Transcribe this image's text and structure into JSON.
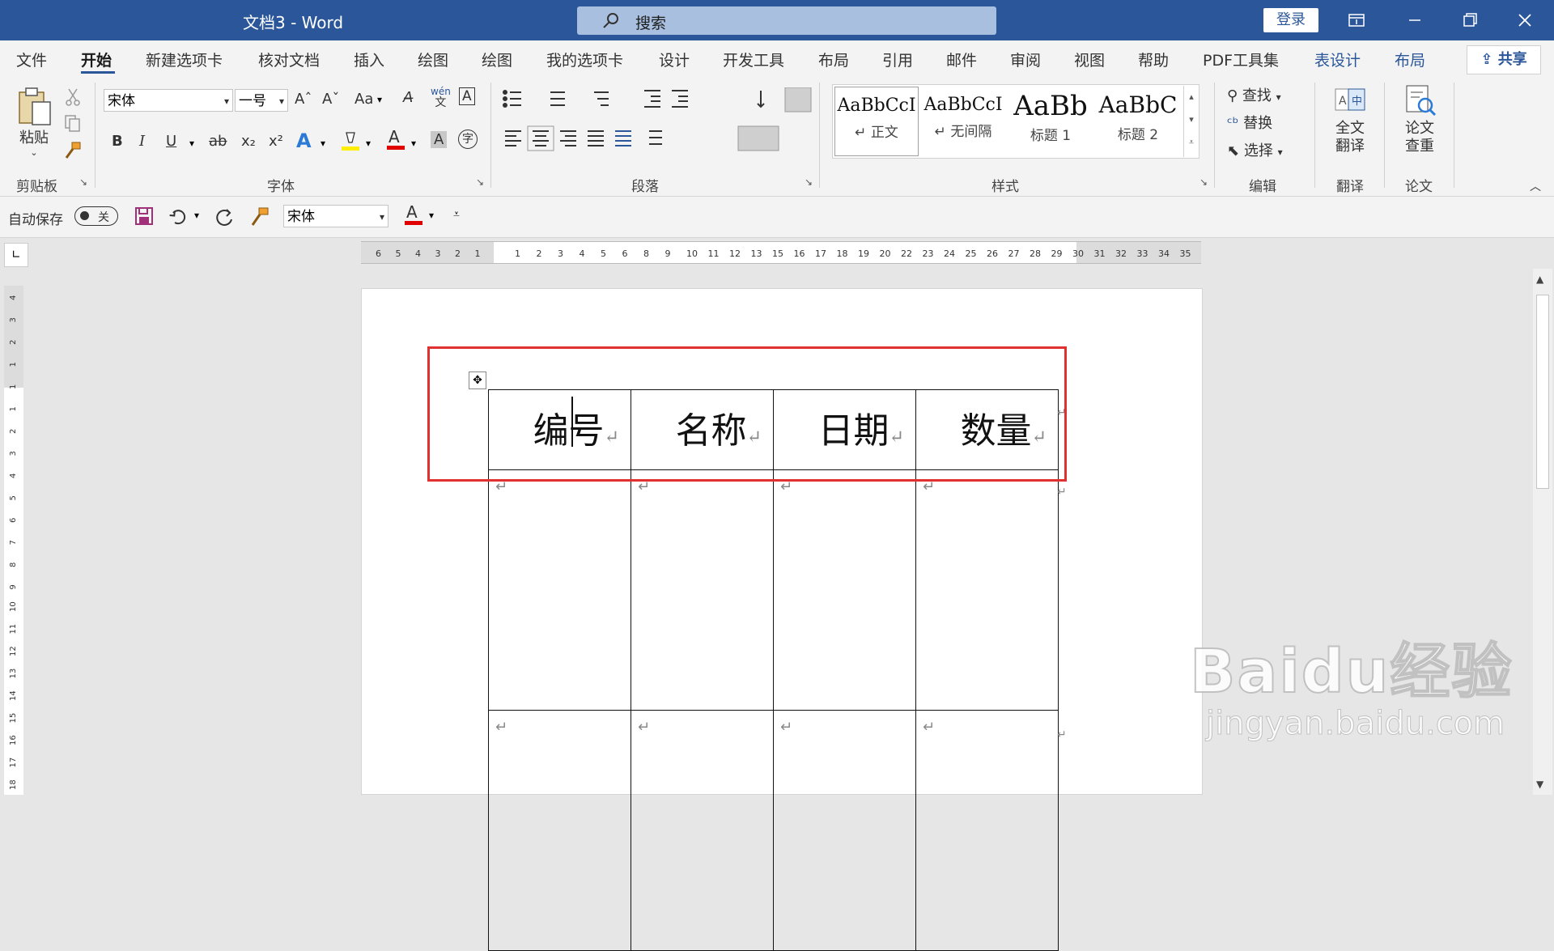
{
  "titlebar": {
    "doc_title": "文档3  -  Word",
    "search_placeholder": "搜索",
    "login_label": "登录"
  },
  "tabs": [
    {
      "label": "文件"
    },
    {
      "label": "开始"
    },
    {
      "label": "新建选项卡"
    },
    {
      "label": "核对文档"
    },
    {
      "label": "插入"
    },
    {
      "label": "绘图"
    },
    {
      "label": "绘图"
    },
    {
      "label": "我的选项卡"
    },
    {
      "label": "设计"
    },
    {
      "label": "开发工具"
    },
    {
      "label": "布局"
    },
    {
      "label": "引用"
    },
    {
      "label": "邮件"
    },
    {
      "label": "审阅"
    },
    {
      "label": "视图"
    },
    {
      "label": "帮助"
    },
    {
      "label": "PDF工具集"
    },
    {
      "label": "表设计"
    },
    {
      "label": "布局"
    }
  ],
  "share_label": "共享",
  "ribbon": {
    "clipboard": {
      "paste_label": "粘贴",
      "group_label": "剪贴板"
    },
    "font": {
      "font_name": "宋体",
      "font_size": "一号",
      "group_label": "字体",
      "wen_top": "wén",
      "wen_bottom": "文",
      "ao_icon": "A",
      "yuan_icon": "字",
      "bold": "B",
      "italic": "I",
      "underline": "U",
      "strike": "ab",
      "subscript": "x₂",
      "superscript": "x²",
      "grow": "Aˆ",
      "shrink": "Aˇ",
      "case": "Aa"
    },
    "paragraph": {
      "group_label": "段落"
    },
    "styles": {
      "group_label": "样式",
      "items": [
        {
          "sample": "AaBbCcI",
          "name": "↵ 正文"
        },
        {
          "sample": "AaBbCcI",
          "name": "↵ 无间隔"
        },
        {
          "sample": "AaBb",
          "name": "标题 1"
        },
        {
          "sample": "AaBbC",
          "name": "标题 2"
        }
      ]
    },
    "editing": {
      "find": "查找",
      "replace": "替换",
      "select": "选择",
      "group_label": "编辑"
    },
    "translate": {
      "label_line1": "全文",
      "label_line2": "翻译",
      "group_label": "翻译"
    },
    "paper": {
      "label_line1": "论文",
      "label_line2": "查重",
      "group_label": "论文"
    }
  },
  "qat": {
    "autosave_label": "自动保存",
    "toggle_state": "关",
    "font_name": "宋体"
  },
  "ruler": {
    "left_numbers": [
      "6",
      "5",
      "4",
      "3",
      "2",
      "1"
    ],
    "right_numbers": [
      "1",
      "2",
      "3",
      "4",
      "5",
      "6",
      "8",
      "9",
      "10",
      "11",
      "12",
      "13",
      "15",
      "16",
      "17",
      "18",
      "19",
      "20",
      "22",
      "23",
      "24",
      "25",
      "26",
      "27",
      "28",
      "29",
      "30",
      "31",
      "32",
      "33",
      "34",
      "35"
    ],
    "vertical_numbers": [
      "4",
      "3",
      "2",
      "1",
      "1",
      "1",
      "2",
      "3",
      "4",
      "5",
      "6",
      "7",
      "8",
      "9",
      "10",
      "11",
      "12",
      "13",
      "14",
      "15",
      "16",
      "17",
      "18"
    ]
  },
  "table": {
    "headers": [
      "编号",
      "名称",
      "日期",
      "数量"
    ],
    "paragraph_mark": "↵",
    "body_rows": 2
  },
  "watermark": {
    "brand": "Baidu经验",
    "url": "jingyan.baidu.com"
  }
}
